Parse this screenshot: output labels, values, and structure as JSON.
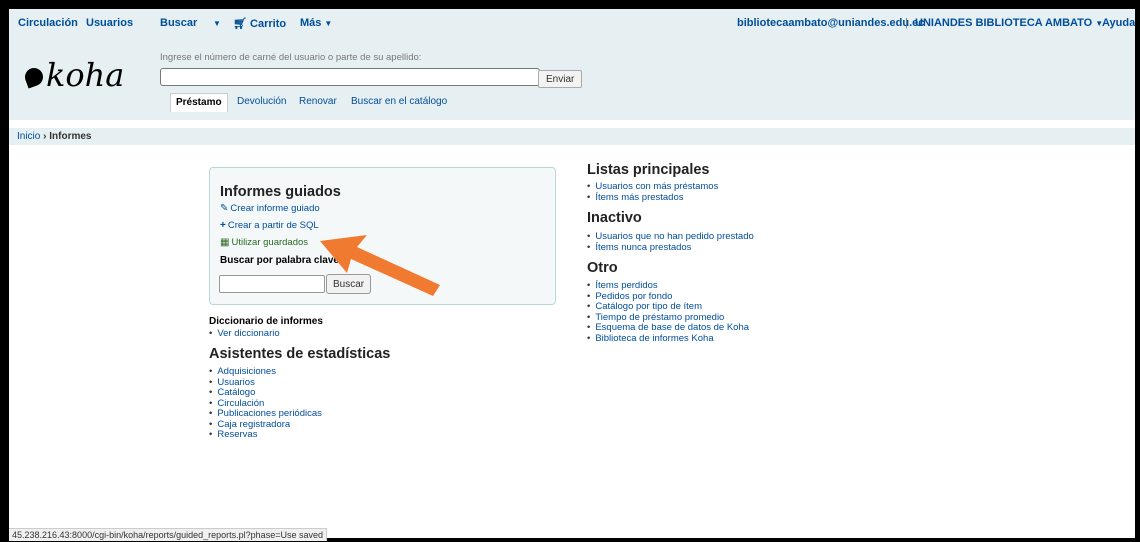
{
  "navbar": {
    "items": [
      {
        "label": "Circulación"
      },
      {
        "label": "Usuarios"
      },
      {
        "label": "Buscar"
      },
      {
        "label": "Carrito"
      },
      {
        "label": "Más"
      }
    ],
    "user": "bibliotecaambato@uniandes.edu.ec",
    "library": "UNIANDES BIBLIOTECA AMBATO",
    "help": "Ayuda"
  },
  "header": {
    "logo": "koha",
    "search_hint": "Ingrese el número de carné del usuario o parte de su apellido:",
    "search_value": "",
    "submit": "Enviar",
    "tabs": [
      "Préstamo",
      "Devolución",
      "Renovar",
      "Buscar en el catálogo"
    ]
  },
  "breadcrumb": {
    "home": "Inicio",
    "sep": "›",
    "current": "Informes"
  },
  "guided": {
    "title": "Informes guiados",
    "links": [
      "Crear informe guiado",
      "Crear a partir de SQL",
      "Utilizar guardados"
    ],
    "keyword_label": "Buscar por palabra clave:",
    "keyword_value": "",
    "search_button": "Buscar"
  },
  "dictionary": {
    "title": "Diccionario de informes",
    "items": [
      "Ver diccionario"
    ]
  },
  "stats": {
    "title": "Asistentes de estadísticas",
    "items": [
      "Adquisiciones",
      "Usuarios",
      "Catálogo",
      "Circulación",
      "Publicaciones periódicas",
      "Caja registradora",
      "Reservas"
    ]
  },
  "top_lists": {
    "title": "Listas principales",
    "items": [
      "Usuarios con más préstamos",
      "Ítems más prestados"
    ]
  },
  "inactive": {
    "title": "Inactivo",
    "items": [
      "Usuarios que no han pedido prestado",
      "Ítems nunca prestados"
    ]
  },
  "other": {
    "title": "Otro",
    "items": [
      "Ítems perdidos",
      "Pedidos por fondo",
      "Catálogo por tipo de ítem",
      "Tiempo de préstamo promedio",
      "Esquema de base de datos de Koha",
      "Biblioteca de informes Koha"
    ]
  },
  "status_bar": "45.238.216.43:8000/cgi-bin/koha/reports/guided_reports.pl?phase=Use saved",
  "colors": {
    "link": "#004d99",
    "header_bg": "#e6f0f2",
    "arrow": "#f07a30",
    "guided_link": "#2a6a22"
  },
  "icons": [
    "cart-icon",
    "caret-down-icon",
    "pencil-icon",
    "plus-icon",
    "list-icon",
    "arrow-pointer-icon"
  ]
}
